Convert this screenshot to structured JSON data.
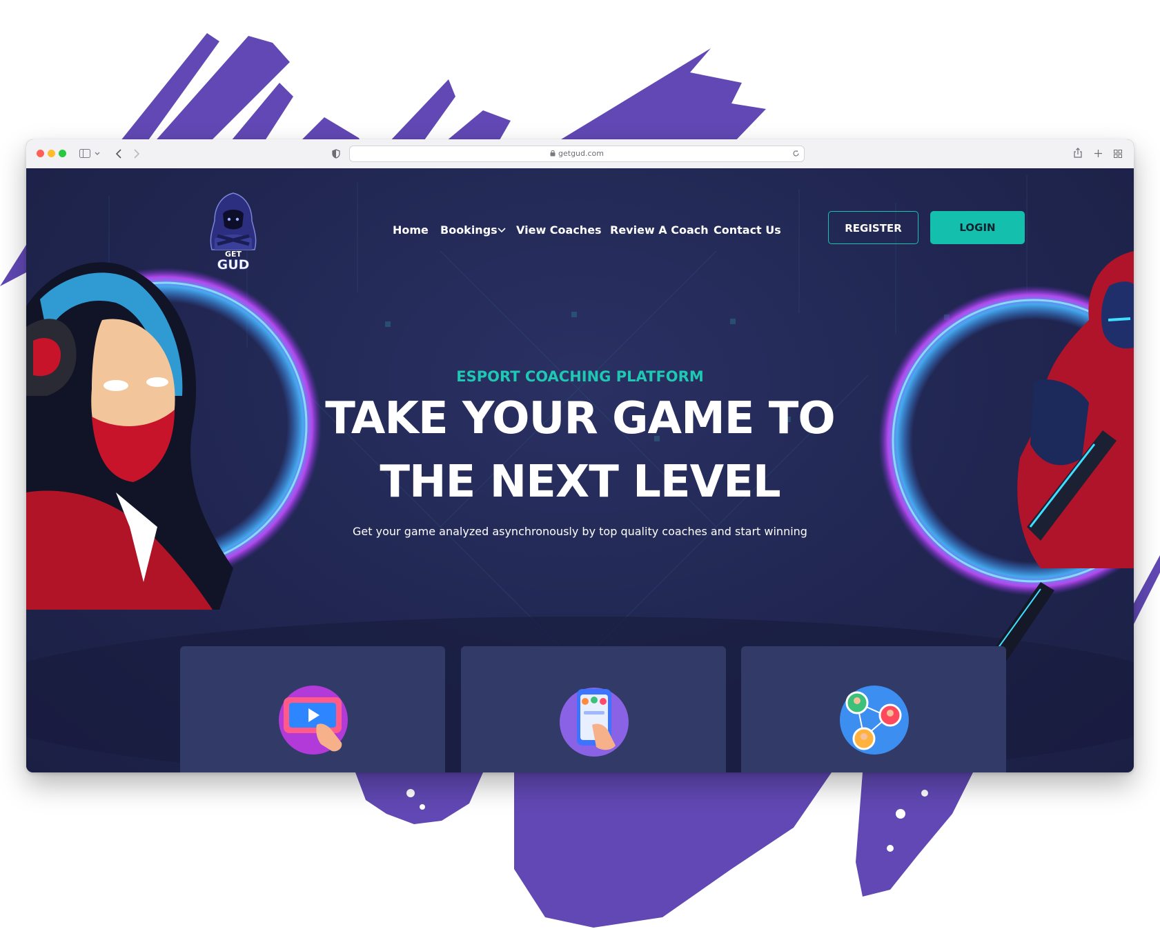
{
  "browser": {
    "url": "getgud.com",
    "icons": [
      "sidebar-icon",
      "chevron-down-icon",
      "back-icon",
      "forward-icon",
      "shield-icon",
      "lock-icon",
      "reload-icon",
      "share-icon",
      "new-tab-icon",
      "tab-overview-icon"
    ]
  },
  "logo": {
    "line1": "GET",
    "line2": "GUD"
  },
  "nav": {
    "home": "Home",
    "bookings": "Bookings",
    "view_coaches": "View Coaches",
    "review_coach": "Review A Coach",
    "contact": "Contact Us"
  },
  "auth": {
    "register": "REGISTER",
    "login": "LOGIN"
  },
  "hero": {
    "eyebrow": "ESPORT COACHING PLATFORM",
    "headline_line1": "TAKE YOUR GAME TO",
    "headline_line2": "THE NEXT LEVEL",
    "subtitle": "Get your game analyzed asynchronously by top quality coaches and start winning"
  },
  "feature_cards": [
    {
      "icon": "video-upload-icon"
    },
    {
      "icon": "coach-selection-icon"
    },
    {
      "icon": "network-connect-icon"
    }
  ],
  "colors": {
    "brush": "#6148b4",
    "accent": "#14c0ad",
    "hero_bg": "#202650",
    "card_bg": "#323a68"
  }
}
